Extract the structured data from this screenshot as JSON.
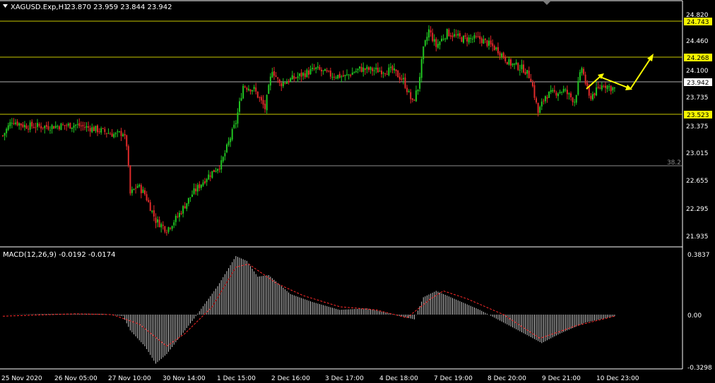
{
  "header": {
    "symbol": "XAGUSD.Exp,H1",
    "ohlc": "23.870 23.959 23.844 23.942"
  },
  "colors": {
    "background": "#000000",
    "bull_candle": "#21c421",
    "bear_candle": "#e02a2a",
    "axis": "#ffffff",
    "level_line": "#c8c800",
    "level_tag": "#f6f600",
    "bid_line": "#b0b0b0",
    "macd_hist": "#c8c8c8",
    "macd_signal": "#ff2a2a",
    "arrow": "#ffff00"
  },
  "price_axis": {
    "ticks": [
      "24.820",
      "24.460",
      "24.100",
      "23.735",
      "23.375",
      "23.015",
      "22.655",
      "22.295",
      "21.935"
    ],
    "levels": [
      "24.743",
      "24.268",
      "23.523"
    ],
    "bid": "23.942",
    "fib_label": "38.2"
  },
  "macd": {
    "label": "MACD(12,26,9) -0.0192 -0.0174",
    "ticks": [
      "0.3837",
      "0.00",
      "-0.3298"
    ]
  },
  "time_axis": {
    "labels": [
      "25 Nov 2020",
      "26 Nov 05:00",
      "27 Nov 10:00",
      "30 Nov 14:00",
      "1 Dec 15:00",
      "2 Dec 16:00",
      "3 Dec 17:00",
      "4 Dec 18:00",
      "7 Dec 19:00",
      "8 Dec 20:00",
      "9 Dec 21:00",
      "10 Dec 23:00"
    ]
  },
  "chart_data": {
    "type": "candlestick",
    "symbol": "XAGUSD.Exp",
    "timeframe": "H1",
    "ylim": [
      21.87,
      24.98
    ],
    "horizontal_levels": [
      24.743,
      24.268,
      23.523
    ],
    "fib_level": {
      "label": "38.2",
      "price": 22.87
    },
    "bid_price": 23.942,
    "close_anchors": [
      [
        0,
        23.32
      ],
      [
        5,
        23.52
      ],
      [
        12,
        23.45
      ],
      [
        25,
        23.44
      ],
      [
        40,
        23.46
      ],
      [
        50,
        23.41
      ],
      [
        62,
        23.33
      ],
      [
        66,
        23.36
      ],
      [
        68,
        23.2
      ],
      [
        70,
        22.55
      ],
      [
        74,
        22.66
      ],
      [
        78,
        22.55
      ],
      [
        84,
        22.2
      ],
      [
        90,
        22.08
      ],
      [
        96,
        22.25
      ],
      [
        104,
        22.55
      ],
      [
        112,
        22.77
      ],
      [
        120,
        22.95
      ],
      [
        128,
        23.5
      ],
      [
        132,
        23.98
      ],
      [
        138,
        23.93
      ],
      [
        144,
        23.68
      ],
      [
        148,
        24.2
      ],
      [
        152,
        24.0
      ],
      [
        162,
        24.1
      ],
      [
        172,
        24.2
      ],
      [
        180,
        24.12
      ],
      [
        188,
        24.1
      ],
      [
        196,
        24.2
      ],
      [
        206,
        24.18
      ],
      [
        214,
        24.18
      ],
      [
        220,
        24.05
      ],
      [
        225,
        23.75
      ],
      [
        228,
        23.95
      ],
      [
        231,
        24.45
      ],
      [
        234,
        24.71
      ],
      [
        238,
        24.5
      ],
      [
        244,
        24.68
      ],
      [
        252,
        24.6
      ],
      [
        262,
        24.6
      ],
      [
        272,
        24.45
      ],
      [
        278,
        24.28
      ],
      [
        286,
        24.2
      ],
      [
        290,
        24.08
      ],
      [
        294,
        23.62
      ],
      [
        298,
        23.85
      ],
      [
        308,
        23.92
      ],
      [
        314,
        23.78
      ],
      [
        318,
        24.22
      ],
      [
        322,
        23.82
      ],
      [
        330,
        24.0
      ],
      [
        334,
        23.95
      ],
      [
        336,
        23.94
      ]
    ],
    "macd": {
      "ylim": [
        -0.3298,
        0.3837
      ],
      "histogram_anchors": [
        [
          0,
          0.0
        ],
        [
          30,
          0.005
        ],
        [
          55,
          0.005
        ],
        [
          66,
          -0.01
        ],
        [
          70,
          -0.1
        ],
        [
          78,
          -0.2
        ],
        [
          84,
          -0.31
        ],
        [
          90,
          -0.25
        ],
        [
          100,
          -0.1
        ],
        [
          106,
          -0.01
        ],
        [
          118,
          0.18
        ],
        [
          128,
          0.37
        ],
        [
          134,
          0.34
        ],
        [
          140,
          0.24
        ],
        [
          146,
          0.25
        ],
        [
          158,
          0.13
        ],
        [
          170,
          0.08
        ],
        [
          185,
          0.03
        ],
        [
          200,
          0.04
        ],
        [
          215,
          0.0
        ],
        [
          226,
          -0.03
        ],
        [
          231,
          0.11
        ],
        [
          238,
          0.15
        ],
        [
          248,
          0.1
        ],
        [
          262,
          0.03
        ],
        [
          275,
          -0.05
        ],
        [
          288,
          -0.13
        ],
        [
          296,
          -0.18
        ],
        [
          306,
          -0.12
        ],
        [
          320,
          -0.05
        ],
        [
          336,
          -0.01
        ]
      ],
      "signal_anchors": [
        [
          0,
          -0.01
        ],
        [
          40,
          0.005
        ],
        [
          60,
          0.0
        ],
        [
          75,
          -0.06
        ],
        [
          90,
          -0.2
        ],
        [
          100,
          -0.12
        ],
        [
          115,
          0.05
        ],
        [
          128,
          0.3
        ],
        [
          135,
          0.32
        ],
        [
          150,
          0.2
        ],
        [
          165,
          0.12
        ],
        [
          185,
          0.05
        ],
        [
          205,
          0.03
        ],
        [
          222,
          -0.02
        ],
        [
          235,
          0.1
        ],
        [
          242,
          0.15
        ],
        [
          255,
          0.1
        ],
        [
          275,
          0.0
        ],
        [
          295,
          -0.15
        ],
        [
          315,
          -0.07
        ],
        [
          336,
          -0.01
        ]
      ]
    }
  }
}
